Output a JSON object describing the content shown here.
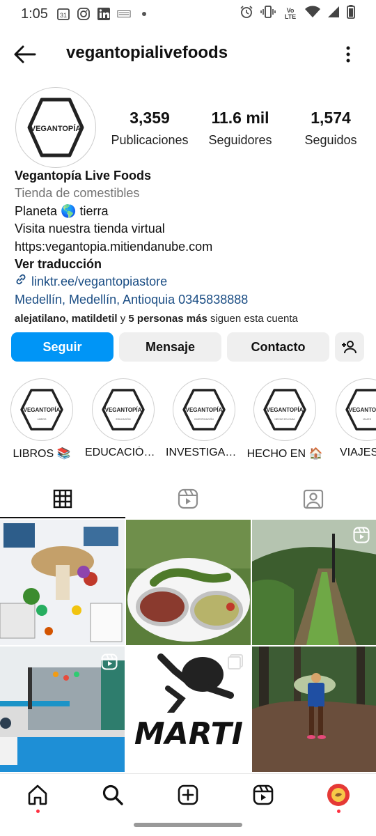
{
  "status_bar": {
    "time": "1:05",
    "calendar_day": "31",
    "icons_left": [
      "calendar-icon",
      "instagram-icon",
      "linkedin-icon",
      "news-icon",
      "dot-icon"
    ],
    "icons_right": [
      "alarm-icon",
      "vibrate-icon",
      "volte-icon",
      "wifi-icon",
      "signal-icon",
      "battery-icon"
    ],
    "volte_label": "Vo LTE"
  },
  "header": {
    "username": "vegantopialivefoods"
  },
  "profile": {
    "logo_text": "VEGANTOPÍA",
    "stats": [
      {
        "value": "3,359",
        "label": "Publicaciones"
      },
      {
        "value": "11.6 mil",
        "label": "Seguidores"
      },
      {
        "value": "1,574",
        "label": "Seguidos"
      }
    ],
    "display_name": "Vegantopía Live Foods",
    "category": "Tienda de comestibles",
    "bio_lines": [
      "Planeta 🌎 tierra",
      "Visita nuestra tienda virtual",
      "https:vegantopia.mitiendanube.com"
    ],
    "translate_label": "Ver traducción",
    "link": "linktr.ee/vegantopiastore",
    "address": "Medellín, Medellín, Antioquia 0345838888",
    "followed_by": {
      "names": "alejatilano, matildetil",
      "middle": " y ",
      "others": "5 personas más",
      "suffix": " siguen esta cuenta"
    }
  },
  "buttons": {
    "follow": "Seguir",
    "message": "Mensaje",
    "contact": "Contacto"
  },
  "highlights": [
    {
      "label": "LIBROS 📚",
      "logo_text": "VEGANTOPÍA",
      "sub": "LIBROS"
    },
    {
      "label": "EDUCACIÓN ...",
      "logo_text": "VEGANTOPÍA",
      "sub": "EDUCACIÓN"
    },
    {
      "label": "INVESTIGACI...",
      "logo_text": "VEGANTOPÍA",
      "sub": "INVESTIGACIÓN"
    },
    {
      "label": "HECHO EN 🏠",
      "logo_text": "VEGANTOPÍA",
      "sub": "HECHO EN CASA"
    },
    {
      "label": "VIAJES",
      "logo_text": "VEGANTOPÍA",
      "sub": "VIAJES"
    }
  ],
  "tabs": [
    "grid-icon",
    "reels-icon",
    "tagged-icon"
  ],
  "grid": {
    "post5_text": "MARTI"
  },
  "bottom_nav": [
    "home-icon",
    "search-icon",
    "create-icon",
    "reels-icon",
    "profile-avatar"
  ],
  "colors": {
    "follow_blue": "#0095f6",
    "link_blue": "#1a4d84",
    "secondary_gray": "#737373",
    "button_gray": "#efefef",
    "notification_red": "#ff3040"
  }
}
